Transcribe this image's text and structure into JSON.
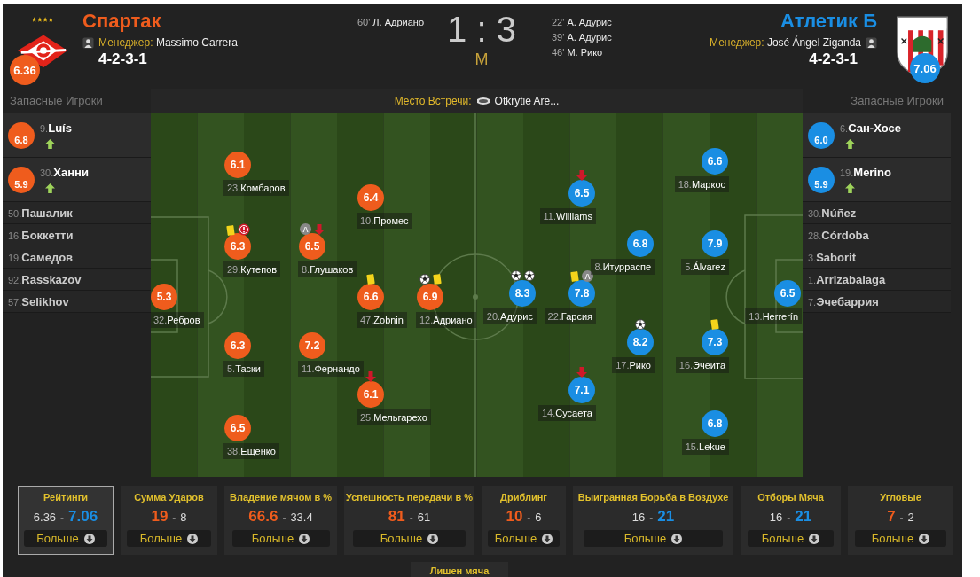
{
  "header": {
    "home": {
      "name": "Спартак",
      "rating": "6.36",
      "manager_label": "Менеджер:",
      "manager": "Massimo Carrera",
      "formation": "4-2-3-1"
    },
    "away": {
      "name": "Атлетик Б",
      "rating": "7.06",
      "manager_label": "Менеджер:",
      "manager": "José Ángel Ziganda",
      "formation": "4-2-3-1"
    },
    "home_scorers": [
      {
        "minute": "60'",
        "player": "Л. Адриано"
      }
    ],
    "score": "1 : 3",
    "status": "М",
    "away_scorers": [
      {
        "minute": "22'",
        "player": "А. Адурис"
      },
      {
        "minute": "39'",
        "player": "А. Адурис"
      },
      {
        "minute": "46'",
        "player": "М. Рико"
      }
    ]
  },
  "venue": {
    "label": "Место Встречи:",
    "value": "Otkrytie Are..."
  },
  "teams": [
    {
      "kind": "home",
      "subs_title": "Запасные Игроки",
      "subs": [
        {
          "number": "9.",
          "name": "Luís",
          "rating": "6.8",
          "subbed_in": true
        },
        {
          "number": "30.",
          "name": "Ханни",
          "rating": "5.9",
          "subbed_in": true
        },
        {
          "number": "50.",
          "name": "Пашалик",
          "subbed_in": false
        },
        {
          "number": "16.",
          "name": "Боккетти",
          "subbed_in": false
        },
        {
          "number": "19.",
          "name": "Самедов",
          "subbed_in": false
        },
        {
          "number": "92.",
          "name": "Rasskazov",
          "subbed_in": false
        },
        {
          "number": "57.",
          "name": "Selikhov",
          "subbed_in": false
        }
      ],
      "players": [
        {
          "number": "32.",
          "name": "Ребров",
          "rating": "5.3"
        },
        {
          "number": "23.",
          "name": "Комбаров",
          "rating": "6.1"
        },
        {
          "number": "29.",
          "name": "Кутепов",
          "rating": "6.3",
          "events": [
            {
              "kind": "yellow_card"
            },
            {
              "kind": "error"
            }
          ]
        },
        {
          "number": "5.",
          "name": "Таски",
          "rating": "6.3"
        },
        {
          "number": "38.",
          "name": "Ещенко",
          "rating": "6.5"
        },
        {
          "number": "8.",
          "name": "Глушаков",
          "rating": "6.5",
          "events": [
            {
              "kind": "captain",
              "label": "A"
            },
            {
              "kind": "sub_off"
            }
          ]
        },
        {
          "number": "11.",
          "name": "Фернандо",
          "rating": "7.2"
        },
        {
          "number": "10.",
          "name": "Промес",
          "rating": "6.4"
        },
        {
          "number": "47.",
          "name": "Zobnin",
          "rating": "6.6",
          "events": [
            {
              "kind": "yellow_card"
            }
          ]
        },
        {
          "number": "25.",
          "name": "Мельгарехо",
          "rating": "6.1",
          "events": [
            {
              "kind": "sub_off"
            }
          ]
        },
        {
          "number": "12.",
          "name": "Адриано",
          "rating": "6.9",
          "events": [
            {
              "kind": "goal"
            },
            {
              "kind": "yellow_card"
            }
          ]
        }
      ]
    },
    {
      "kind": "away",
      "subs_title": "Запасные Игроки",
      "subs": [
        {
          "number": "6.",
          "name": "Сан-Хосе",
          "rating": "6.0",
          "subbed_in": true
        },
        {
          "number": "19.",
          "name": "Merino",
          "rating": "5.9",
          "subbed_in": true
        },
        {
          "number": "30.",
          "name": "Núñez",
          "subbed_in": false
        },
        {
          "number": "28.",
          "name": "Córdoba",
          "subbed_in": false
        },
        {
          "number": "3.",
          "name": "Saborit",
          "subbed_in": false
        },
        {
          "number": "1.",
          "name": "Arrizabalaga",
          "subbed_in": false
        },
        {
          "number": "7.",
          "name": "Эчебаррия",
          "subbed_in": false
        }
      ],
      "players": [
        {
          "number": "20.",
          "name": "Адурис",
          "rating": "8.3",
          "events": [
            {
              "kind": "goal"
            },
            {
              "kind": "goal"
            }
          ]
        },
        {
          "number": "11.",
          "name": "Williams",
          "rating": "6.5",
          "events": [
            {
              "kind": "sub_off"
            }
          ]
        },
        {
          "number": "22.",
          "name": "Гарсия",
          "rating": "7.8",
          "events": [
            {
              "kind": "yellow_card"
            },
            {
              "kind": "captain",
              "label": "A"
            }
          ]
        },
        {
          "number": "14.",
          "name": "Сусаета",
          "rating": "7.1",
          "events": [
            {
              "kind": "sub_off"
            }
          ]
        },
        {
          "number": "8.",
          "name": "Итурраспе",
          "rating": "6.8"
        },
        {
          "number": "17.",
          "name": "Рико",
          "rating": "8.2",
          "events": [
            {
              "kind": "goal"
            }
          ]
        },
        {
          "number": "18.",
          "name": "Маркос",
          "rating": "6.6"
        },
        {
          "number": "5.",
          "name": "Álvarez",
          "rating": "7.9"
        },
        {
          "number": "16.",
          "name": "Эчеита",
          "rating": "7.3",
          "events": [
            {
              "kind": "yellow_card"
            }
          ]
        },
        {
          "number": "15.",
          "name": "Lekue",
          "rating": "6.8"
        },
        {
          "number": "13.",
          "name": "Herrerín",
          "rating": "6.5"
        }
      ]
    }
  ],
  "stats": [
    {
      "title": "Рейтинги",
      "home": {
        "value": "6.36",
        "leading": false
      },
      "separator": "-",
      "away": {
        "value": "7.06",
        "leading": true
      },
      "more": "Больше",
      "selected": true
    },
    {
      "title": "Сумма Ударов",
      "home": {
        "value": "19",
        "leading": true
      },
      "separator": "-",
      "away": {
        "value": "8",
        "leading": false
      },
      "more": "Больше",
      "selected": false
    },
    {
      "title": "Владение мячом в %",
      "home": {
        "value": "66.6",
        "leading": true
      },
      "separator": "-",
      "away": {
        "value": "33.4",
        "leading": false
      },
      "more": "Больше",
      "selected": false
    },
    {
      "title": "Успешность передачи в %",
      "home": {
        "value": "81",
        "leading": true
      },
      "separator": "-",
      "away": {
        "value": "61",
        "leading": false
      },
      "more": "Больше",
      "selected": false
    },
    {
      "title": "Дриблинг",
      "home": {
        "value": "10",
        "leading": true
      },
      "separator": "-",
      "away": {
        "value": "6",
        "leading": false
      },
      "more": "Больше",
      "selected": false
    },
    {
      "title": "Выигранная Борьба в Воздухе",
      "home": {
        "value": "16",
        "leading": false
      },
      "separator": "-",
      "away": {
        "value": "21",
        "leading": true
      },
      "more": "Больше",
      "selected": false
    },
    {
      "title": "Отборы Мяча",
      "home": {
        "value": "16",
        "leading": false
      },
      "separator": "-",
      "away": {
        "value": "21",
        "leading": true
      },
      "more": "Больше",
      "selected": false
    },
    {
      "title": "Угловые",
      "home": {
        "value": "7",
        "leading": true
      },
      "separator": "-",
      "away": {
        "value": "2",
        "leading": false
      },
      "more": "Больше",
      "selected": false
    }
  ],
  "bottom_tab": {
    "label": "Лишен мяча"
  }
}
